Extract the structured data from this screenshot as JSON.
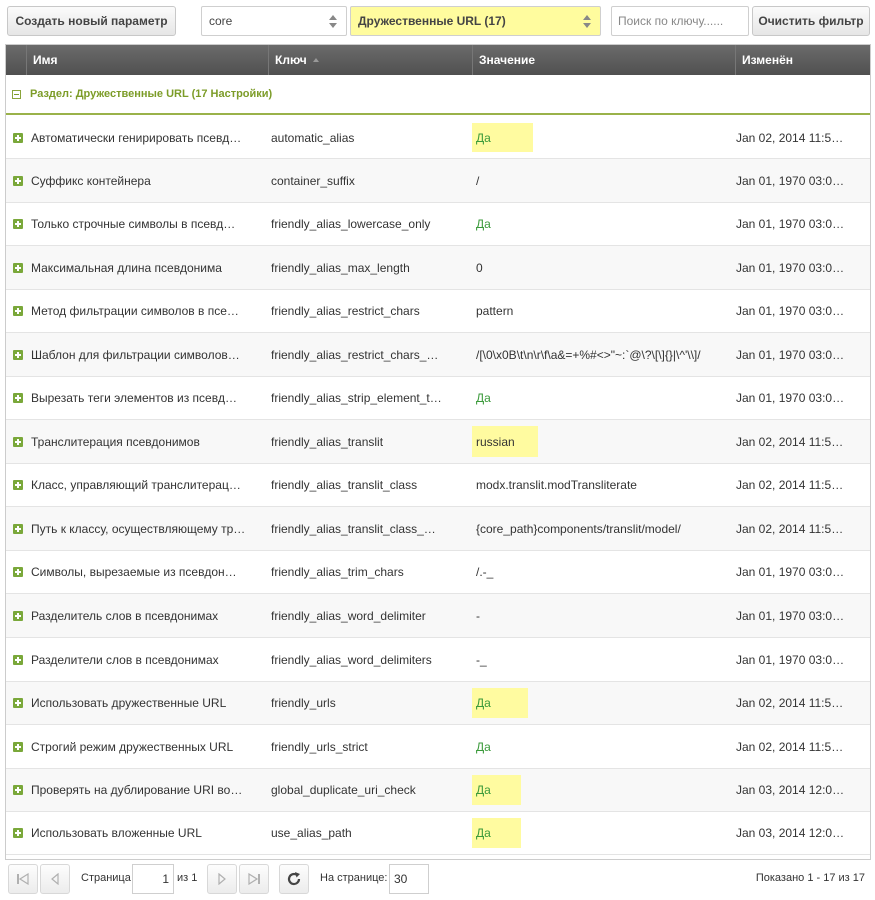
{
  "toolbar": {
    "create_label": "Создать новый параметр",
    "namespace_value": "core",
    "area_value": "Дружественные URL (17)",
    "search_placeholder": "Поиск по ключу......",
    "clear_label": "Очистить фильтр"
  },
  "grid": {
    "columns": [
      "Имя",
      "Ключ",
      "Значение",
      "Изменён"
    ],
    "group_label": "Раздел: Дружественные URL (17 Настройки)",
    "rows": [
      {
        "name": "Автоматически генирировать псевд…",
        "key": "automatic_alias",
        "value": "Да",
        "date": "Jan 02, 2014 11:5…"
      },
      {
        "name": "Суффикс контейнера",
        "key": "container_suffix",
        "value": "/",
        "date": "Jan 01, 1970 03:0…"
      },
      {
        "name": "Только строчные символы в псевд…",
        "key": "friendly_alias_lowercase_only",
        "value": "Да",
        "date": "Jan 01, 1970 03:0…"
      },
      {
        "name": "Максимальная длина псевдонима",
        "key": "friendly_alias_max_length",
        "value": "0",
        "date": "Jan 01, 1970 03:0…"
      },
      {
        "name": "Метод фильтрации символов в псе…",
        "key": "friendly_alias_restrict_chars",
        "value": "pattern",
        "date": "Jan 01, 1970 03:0…"
      },
      {
        "name": "Шаблон для фильтрации символов…",
        "key": "friendly_alias_restrict_chars_…",
        "value": "/[\\0\\x0B\\t\\n\\r\\f\\a&=+%#<>\"~:`@\\?\\[\\]{}|\\^'\\\\]/",
        "date": "Jan 01, 1970 03:0…"
      },
      {
        "name": "Вырезать теги элементов из псевд…",
        "key": "friendly_alias_strip_element_t…",
        "value": "Да",
        "date": "Jan 01, 1970 03:0…"
      },
      {
        "name": "Транслитерация псевдонимов",
        "key": "friendly_alias_translit",
        "value": "russian",
        "date": "Jan 02, 2014 11:5…"
      },
      {
        "name": "Класс, управляющий транслитерац…",
        "key": "friendly_alias_translit_class",
        "value": "modx.translit.modTransliterate",
        "date": "Jan 02, 2014 11:5…"
      },
      {
        "name": "Путь к классу, осуществляющему тр…",
        "key": "friendly_alias_translit_class_…",
        "value": "{core_path}components/translit/model/",
        "date": "Jan 02, 2014 11:5…"
      },
      {
        "name": "Символы, вырезаемые из псевдон…",
        "key": "friendly_alias_trim_chars",
        "value": "/.-_",
        "date": "Jan 01, 1970 03:0…"
      },
      {
        "name": "Разделитель слов в псевдонимах",
        "key": "friendly_alias_word_delimiter",
        "value": "-",
        "date": "Jan 01, 1970 03:0…"
      },
      {
        "name": "Разделители слов в псевдонимах",
        "key": "friendly_alias_word_delimiters",
        "value": "-_",
        "date": "Jan 01, 1970 03:0…"
      },
      {
        "name": "Использовать дружественные URL",
        "key": "friendly_urls",
        "value": "Да",
        "date": "Jan 02, 2014 11:5…"
      },
      {
        "name": "Строгий режим дружественных URL",
        "key": "friendly_urls_strict",
        "value": "Да",
        "date": "Jan 02, 2014 11:5…"
      },
      {
        "name": "Проверять на дублирование URI во…",
        "key": "global_duplicate_uri_check",
        "value": "Да",
        "date": "Jan 03, 2014 12:0…"
      },
      {
        "name": "Использовать вложенные URL",
        "key": "use_alias_path",
        "value": "Да",
        "date": "Jan 03, 2014 12:0…"
      }
    ]
  },
  "paging": {
    "page_label": "Страница",
    "page_value": "1",
    "of_label": "из 1",
    "per_page_label": "На странице:",
    "per_page_value": "30",
    "summary": "Показано 1 - 17 из 17"
  },
  "colors": {
    "accent_green": "#7c9c28",
    "yes_green": "#3a9a3a",
    "highlight": "#fffba0"
  }
}
